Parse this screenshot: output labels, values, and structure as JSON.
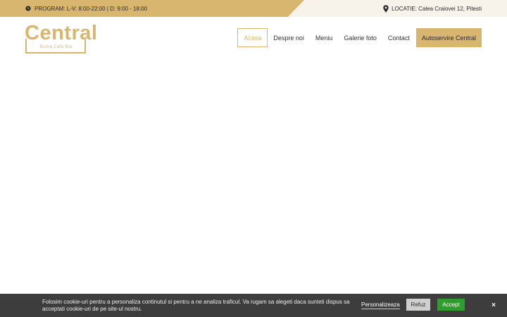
{
  "topbar": {
    "program_text": "PROGRAM: L-V: 8:00-22:00 | D: 9:00 - 18:00",
    "location_text": "LOCATIE: Calea Craiovei 12, Pitesti",
    "program_icon": "clock-icon",
    "location_icon": "pin-icon"
  },
  "logo": {
    "word": "Central",
    "tagline": "Bistro Café Bar"
  },
  "nav": {
    "items": [
      {
        "label": "Acasa"
      },
      {
        "label": "Despre noi"
      },
      {
        "label": "Meniu"
      },
      {
        "label": "Galerie foto"
      },
      {
        "label": "Contact"
      },
      {
        "label": "Autoservire Central"
      }
    ],
    "active_index": 0
  },
  "cookie": {
    "text": "Folosim cookie-uri pentru a personaliza continutul si pentru a ne analiza traficul. Va rugam sa alegeti daca sunteti dispus sa acceptati cookie-uri de pe site-ul nostru.",
    "customize_label": "Personalizeaza",
    "refuse_label": "Refuz",
    "accept_label": "Accept",
    "close_label": "×"
  },
  "colors": {
    "accent": "#d8b66f",
    "topbar_bg": "#f7f3ea",
    "cookie_bg": "#3d3d3d",
    "accept_bg": "#2e9c2e",
    "refuse_bg": "#cfcfcf"
  }
}
